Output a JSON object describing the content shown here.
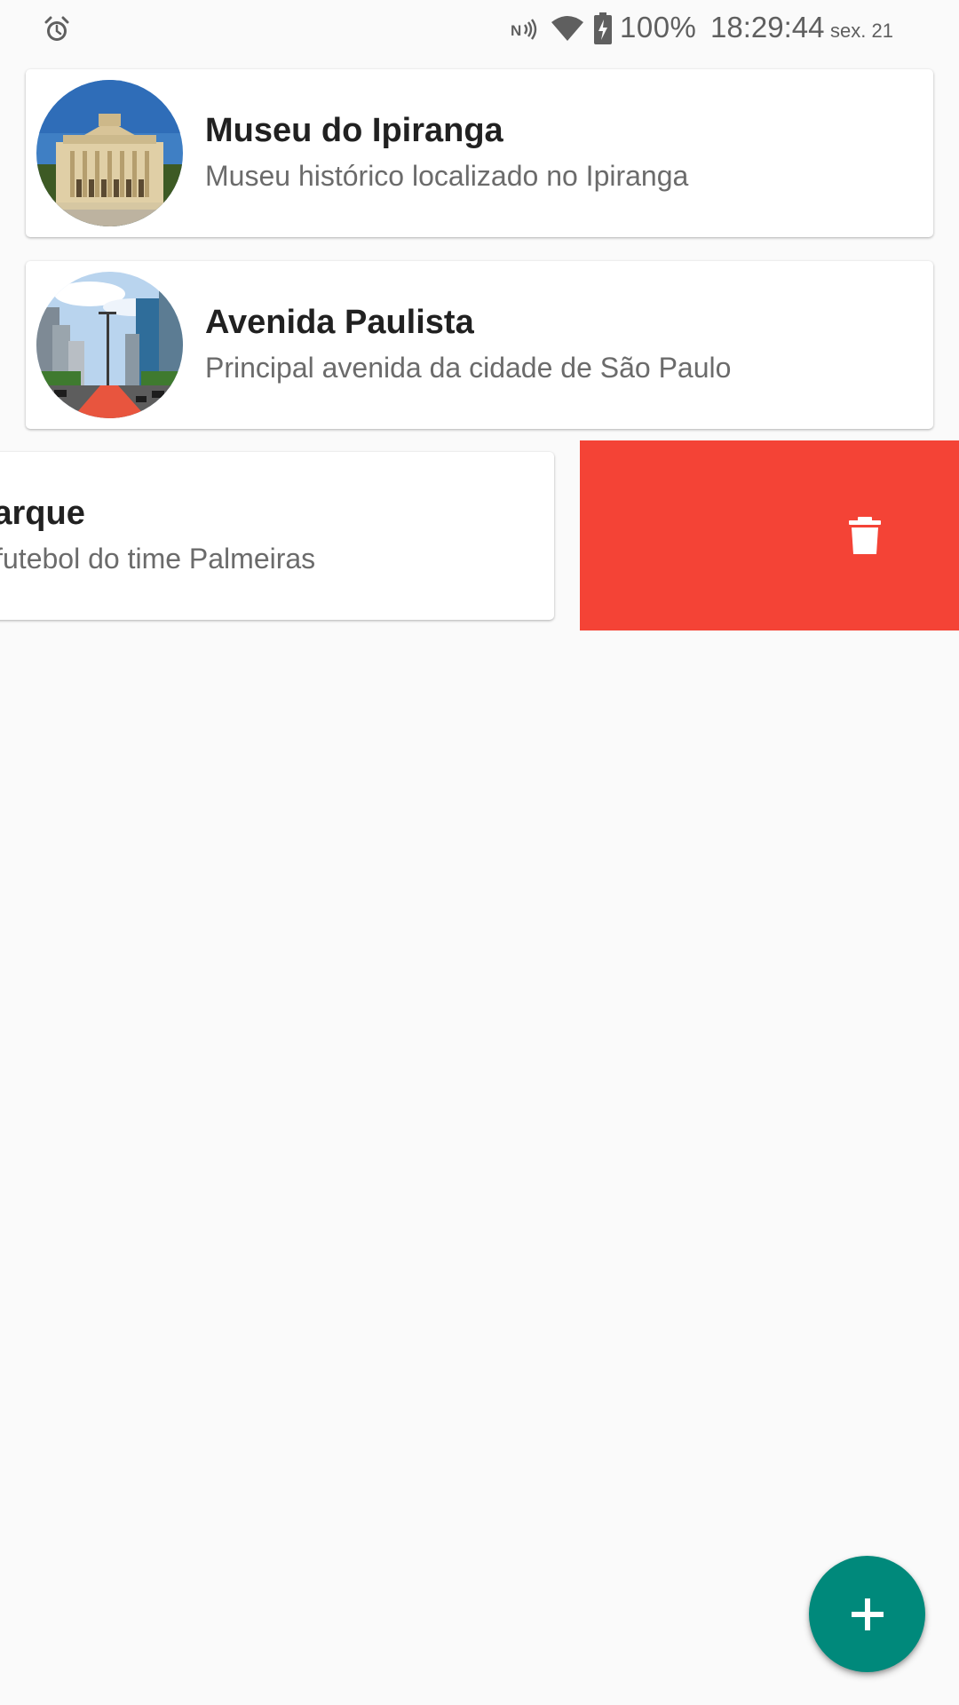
{
  "status_bar": {
    "battery_percent": "100%",
    "time": "18:29:44",
    "date": "sex. 21",
    "icons": [
      "alarm-icon",
      "nfc-icon",
      "wifi-icon",
      "battery-charging-icon"
    ]
  },
  "places": [
    {
      "title": "Museu do Ipiranga",
      "description": "Museu histórico localizado no Ipiranga"
    },
    {
      "title": "Avenida Paulista",
      "description": "Principal avenida da cidade de São Paulo"
    },
    {
      "title": "Allianz Parque",
      "description": "Estádio de futebol do time Palmeiras"
    }
  ],
  "swipe_action": {
    "icon": "trash-icon",
    "color": "#f44336"
  },
  "fab": {
    "icon": "plus-icon",
    "color": "#00897b"
  }
}
